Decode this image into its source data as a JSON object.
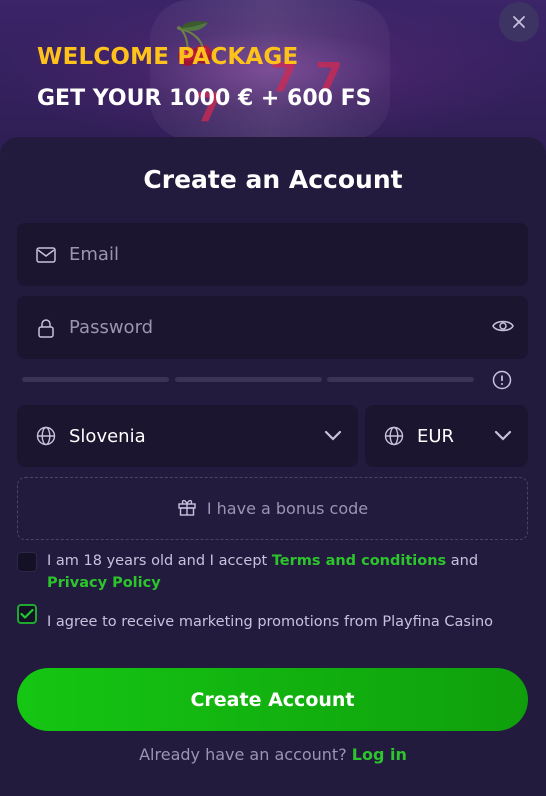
{
  "promo": {
    "headline": "WELCOME PACKAGE",
    "offer": "GET YOUR 1000 € + 600 FS"
  },
  "modal": {
    "title": "Create an Account"
  },
  "form": {
    "email_placeholder": "Email",
    "password_placeholder": "Password",
    "password_strength_segments": 3,
    "country": "Slovenia",
    "currency": "EUR",
    "bonus_code_label": "I have a bonus code"
  },
  "consents": {
    "terms": {
      "checked": false,
      "text_before": "I am 18 years old and I accept ",
      "terms_link": "Terms and conditions",
      "text_middle": " and ",
      "privacy_link": "Privacy Policy"
    },
    "marketing": {
      "checked": true,
      "text": "I agree to receive marketing promotions from Playfina Casino"
    }
  },
  "cta": {
    "label": "Create Account"
  },
  "footer": {
    "question": "Already have an account?",
    "login_link": "Log in"
  },
  "icons": {
    "close": "close-icon",
    "email": "mail-icon",
    "password": "lock-icon",
    "show_password": "eye-icon",
    "info": "info-icon",
    "country": "globe-icon",
    "currency": "globe-icon",
    "dropdown": "chevron-down-icon",
    "bonus": "gift-icon",
    "checked": "check-icon"
  },
  "colors": {
    "accent_yellow": "#ffc21a",
    "brand_green": "#15c613",
    "link_green": "#2cc52c",
    "card_bg": "#221b3e",
    "field_bg": "#1b1530"
  }
}
